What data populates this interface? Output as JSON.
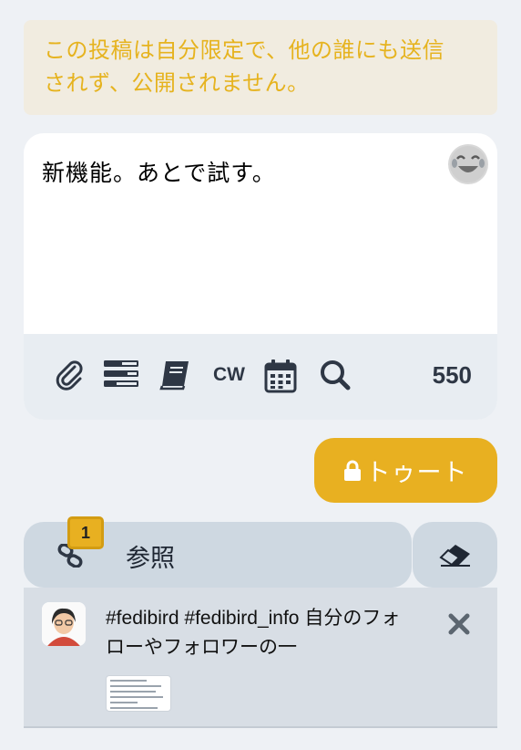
{
  "notice": {
    "line1": "この投稿は自分限定で、他の誰にも送信",
    "line2": "されず、公開されません。"
  },
  "composer": {
    "text": "新機能。あとで試す。",
    "char_count": "550",
    "cw_label": "CW",
    "icons": [
      "paperclip-icon",
      "poll-icon",
      "book-icon",
      "calendar-icon",
      "search-icon",
      "emoji-icon"
    ]
  },
  "submit": {
    "label": "トゥート",
    "icon": "lock-icon"
  },
  "references": {
    "label": "参照",
    "count": "1",
    "card_text": "#fedibird #fedibird_info 自分のフォローやフォロワーの一",
    "colors": {
      "accent": "#e8b021"
    }
  }
}
